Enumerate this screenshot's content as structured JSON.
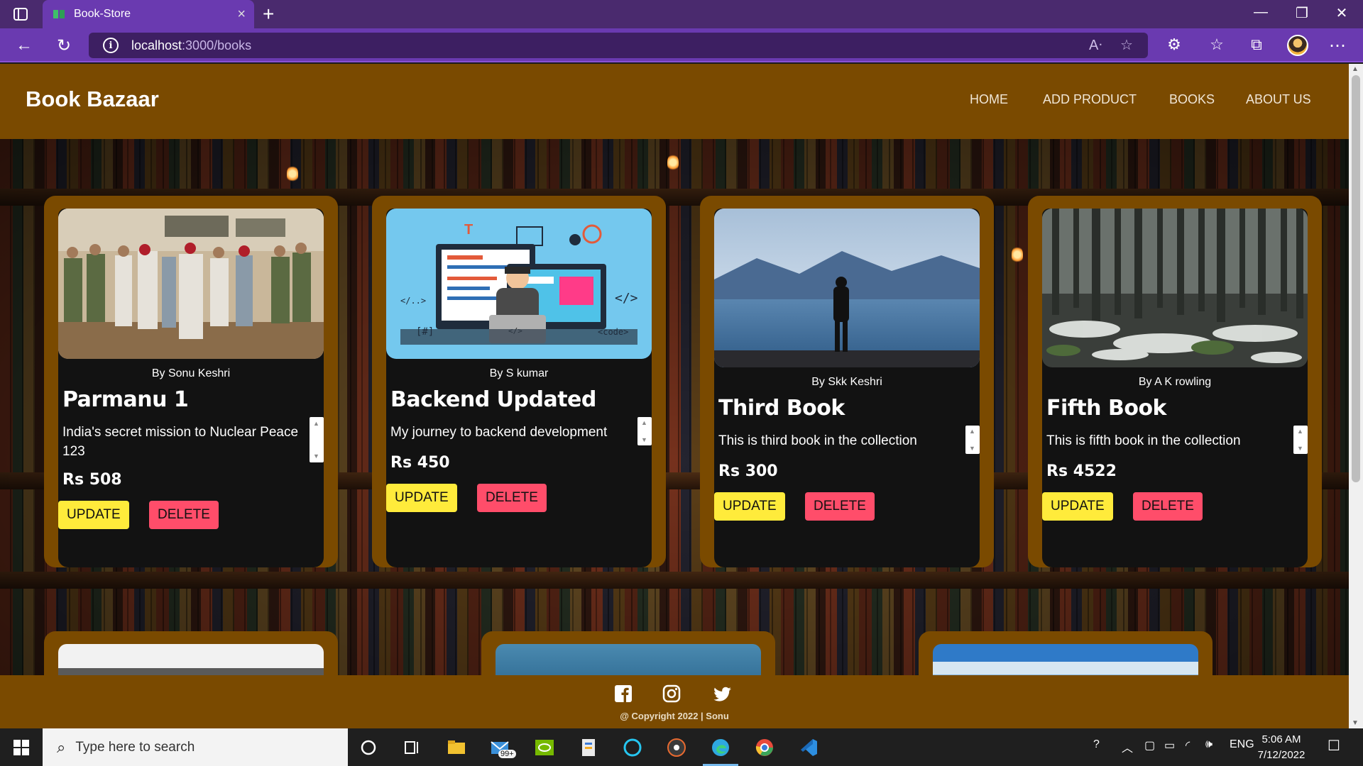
{
  "browser": {
    "tab_title": "Book-Store",
    "url_host": "localhost",
    "url_path": ":3000/books",
    "tab_close": "×",
    "new_tab": "+",
    "window_controls": {
      "minimize": "—",
      "restore": "❐",
      "close": "✕"
    }
  },
  "site": {
    "brand": "Book Bazaar",
    "menu": [
      {
        "label": "HOME"
      },
      {
        "label": "ADD PRODUCT"
      },
      {
        "label": "BOOKS"
      },
      {
        "label": "ABOUT US"
      }
    ]
  },
  "books": [
    {
      "author": "By Sonu Keshri",
      "title": "Parmanu 1",
      "description": "India's secret mission to Nuclear Peace 123",
      "price": "Rs 508",
      "update_label": "UPDATE",
      "delete_label": "DELETE",
      "image": "soldiers-group-photo"
    },
    {
      "author": "By S kumar",
      "title": "Backend Updated",
      "description": "My journey to backend development",
      "price": "Rs 450",
      "update_label": "UPDATE",
      "delete_label": "DELETE",
      "image": "developer-illustration"
    },
    {
      "author": "By Skk Keshri",
      "title": "Third Book",
      "description": "This is third book in the collection",
      "price": "Rs 300",
      "update_label": "UPDATE",
      "delete_label": "DELETE",
      "image": "man-at-lake"
    },
    {
      "author": "By A K rowling",
      "title": "Fifth Book",
      "description": "This is fifth book in the collection",
      "price": "Rs 4522",
      "update_label": "UPDATE",
      "delete_label": "DELETE",
      "image": "snowy-forest"
    }
  ],
  "footer": {
    "copyright": "@ Copyright 2022 | Sonu",
    "social": [
      "facebook-icon",
      "instagram-icon",
      "twitter-icon"
    ]
  },
  "taskbar": {
    "search_placeholder": "Type here to search",
    "mail_badge": "99+",
    "lang": "ENG",
    "time": "5:06 AM",
    "date": "7/12/2022"
  },
  "colors": {
    "brown": "#7a4a00",
    "card_bg": "#121212",
    "update": "#ffeb3b",
    "delete": "#ff4d6a",
    "browser_purple": "#6a3ab0"
  }
}
